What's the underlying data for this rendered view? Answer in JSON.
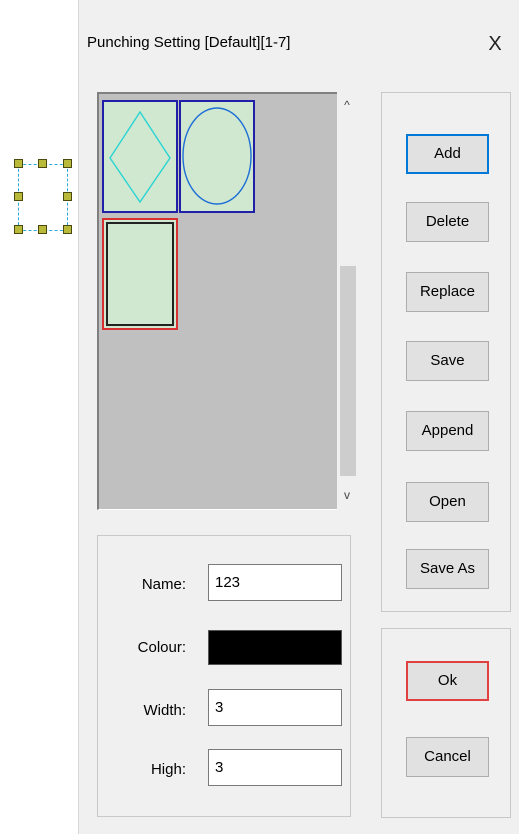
{
  "window": {
    "title": "Punching Setting [Default][1-7]",
    "close_glyph": "X"
  },
  "shape_list": {
    "items": [
      {
        "shape": "diamond",
        "state": "normal"
      },
      {
        "shape": "circle",
        "state": "normal"
      },
      {
        "shape": "square",
        "state": "selected"
      }
    ],
    "scroll_up_glyph": "^",
    "scroll_down_glyph": "v"
  },
  "properties": {
    "name_label": "Name:",
    "name_value": "123",
    "colour_label": "Colour:",
    "colour_value": "#000000",
    "width_label": "Width:",
    "width_value": "3",
    "high_label": "High:",
    "high_value": "3"
  },
  "buttons": {
    "add": "Add",
    "delete": "Delete",
    "replace": "Replace",
    "save": "Save",
    "append": "Append",
    "open": "Open",
    "save_as": "Save As",
    "ok": "Ok",
    "cancel": "Cancel"
  },
  "colors": {
    "thumb_fill": "#cfe8cf",
    "thumb_border": "#1f1fa8",
    "selected_border": "#d83030",
    "diamond_stroke": "#29d4d4",
    "circle_stroke": "#1e6ed8"
  }
}
